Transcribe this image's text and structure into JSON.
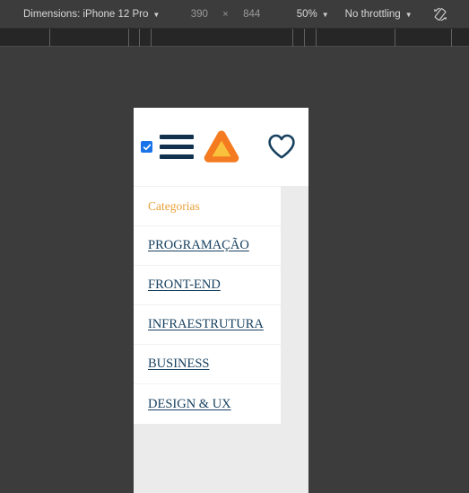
{
  "devtools_toolbar": {
    "dimensions_label": "Dimensions: iPhone 12 Pro",
    "caret": "▼",
    "width_value": "390",
    "height_value": "844",
    "times_symbol": "×",
    "zoom_label": "50%",
    "throttling_label": "No throttling",
    "rotate_icon_name": "rotate-device-icon",
    "colors": {
      "toolbar_bg": "#3c3c3c",
      "ruler_bg": "#262626",
      "text": "#d8d8d8",
      "muted_text": "#9a9a9a"
    }
  },
  "ruler": {
    "tick_positions": [
      55,
      143,
      155,
      168,
      326,
      339,
      352,
      440,
      503
    ]
  },
  "page": {
    "background": "#ebebeb",
    "header": {
      "checkbox_checked": true,
      "checkbox_color": "#1a73e8",
      "menu_toggle_name": "hamburger-menu-icon",
      "logo_name": "triangle-logo",
      "logo_outer_color": "#f47b20",
      "logo_inner_color": "#f9c23c",
      "favorites_name": "heart-icon",
      "favorites_color": "#17405f",
      "navy": "#12314f"
    },
    "dropdown": {
      "heading": "Categorias",
      "heading_color": "#e8a13a",
      "link_color": "#17405f",
      "items": [
        {
          "label": "PROGRAMAÇÃO"
        },
        {
          "label": "FRONT-END"
        },
        {
          "label": "INFRAESTRUTURA"
        },
        {
          "label": "BUSINESS"
        },
        {
          "label": "DESIGN & UX"
        }
      ]
    }
  }
}
